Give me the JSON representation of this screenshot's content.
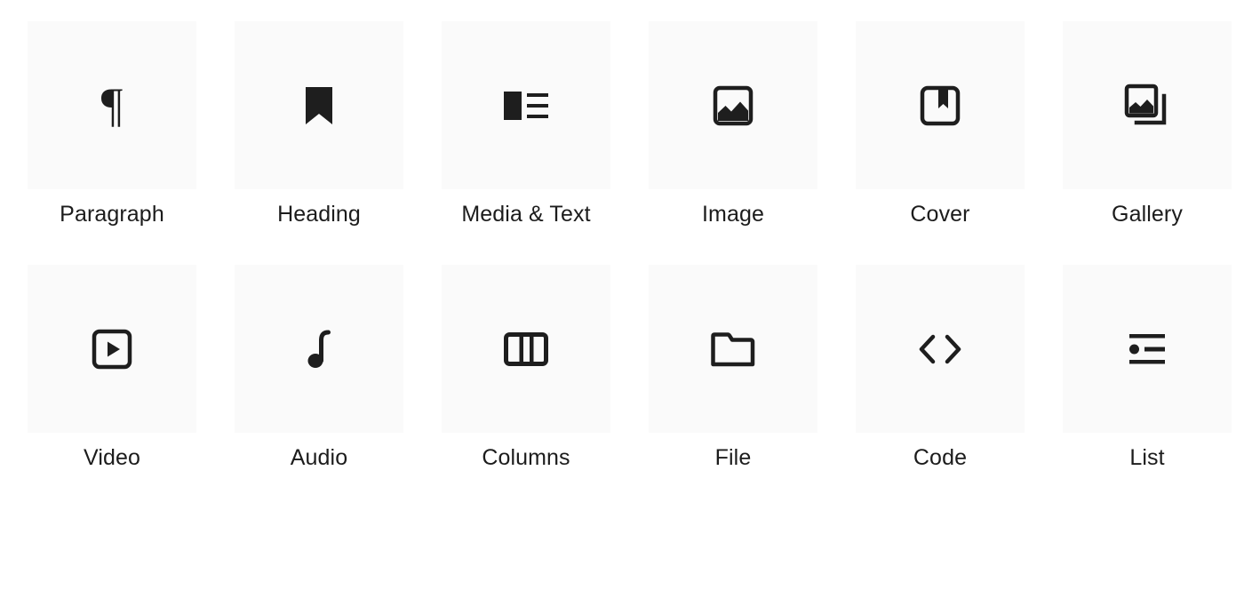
{
  "palette": {
    "page_background": "#ffffff",
    "tile_background": "#fafafa",
    "icon_color": "#1e1e1e",
    "label_color": "#1c1c1c"
  },
  "block_inserter": {
    "blocks": [
      {
        "label": "Paragraph",
        "icon": "paragraph-pilcrow-icon"
      },
      {
        "label": "Heading",
        "icon": "heading-bookmark-icon"
      },
      {
        "label": "Media & Text",
        "icon": "media-and-text-icon"
      },
      {
        "label": "Image",
        "icon": "image-icon"
      },
      {
        "label": "Cover",
        "icon": "cover-icon"
      },
      {
        "label": "Gallery",
        "icon": "gallery-icon"
      },
      {
        "label": "Video",
        "icon": "video-play-icon"
      },
      {
        "label": "Audio",
        "icon": "audio-note-icon"
      },
      {
        "label": "Columns",
        "icon": "columns-icon"
      },
      {
        "label": "File",
        "icon": "file-folder-icon"
      },
      {
        "label": "Code",
        "icon": "code-angle-brackets-icon"
      },
      {
        "label": "List",
        "icon": "list-icon"
      }
    ]
  }
}
